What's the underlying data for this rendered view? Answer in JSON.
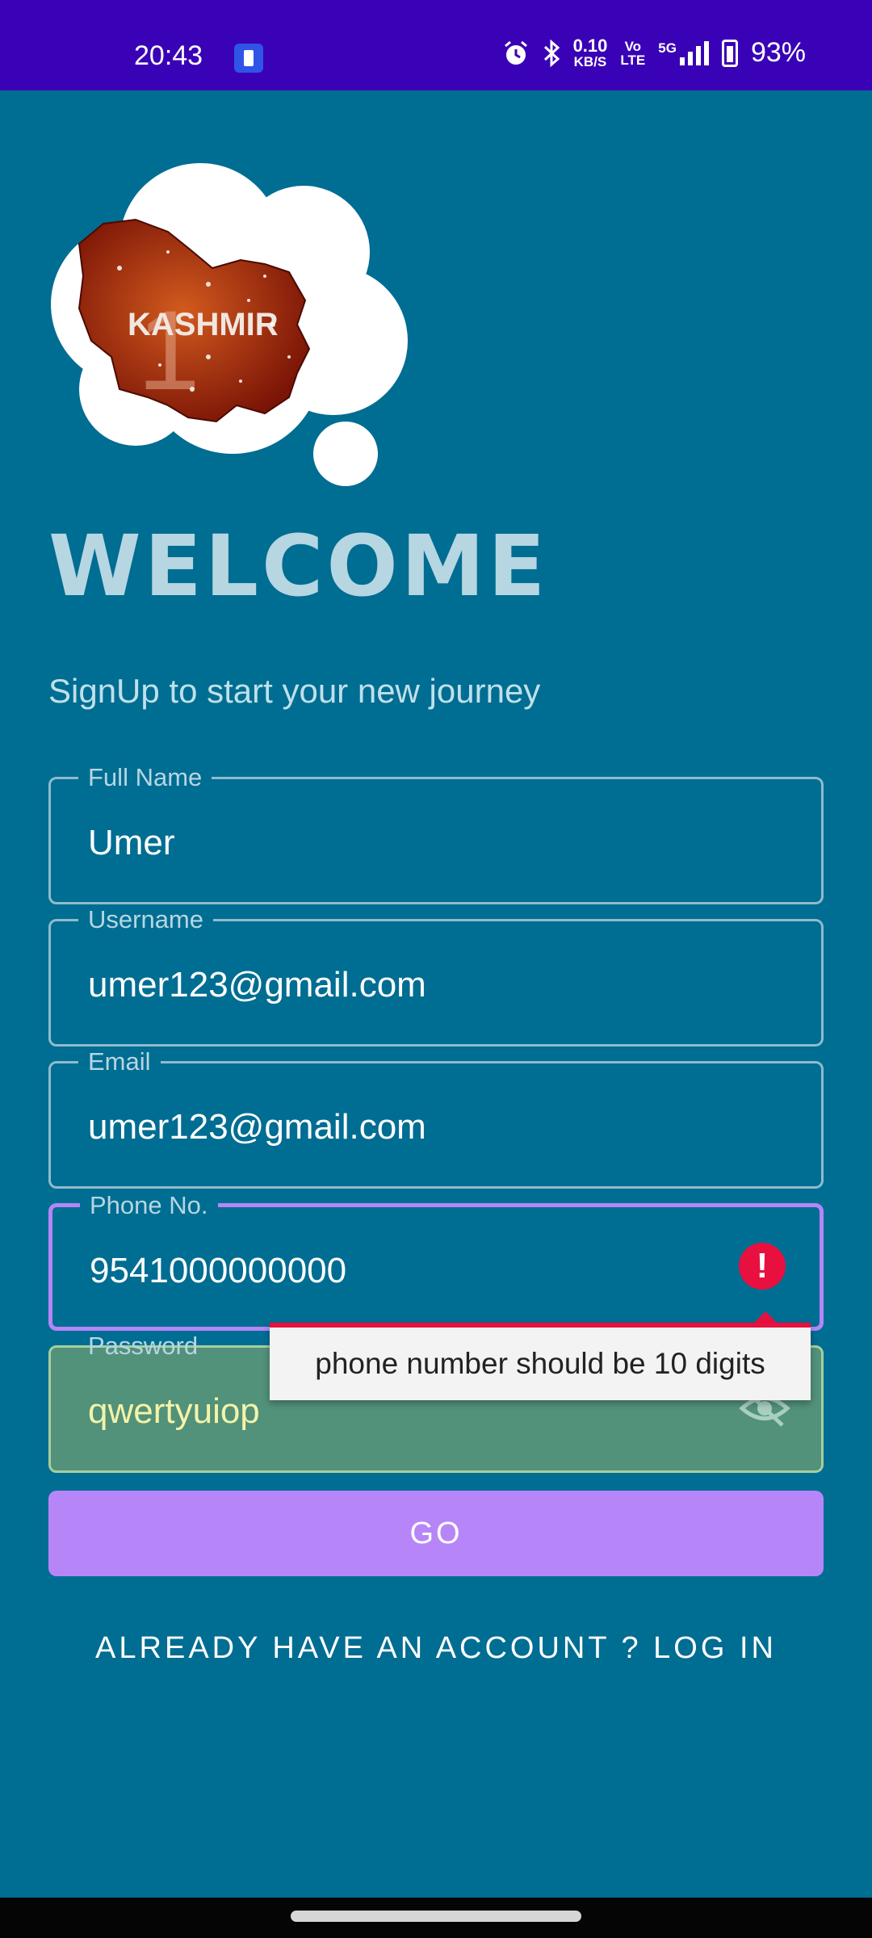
{
  "status_bar": {
    "time": "20:43",
    "net_speed_value": "0.10",
    "net_speed_unit": "KB/S",
    "volte_top": "Vo",
    "volte_bottom": "LTE",
    "network": "5G",
    "battery": "93%"
  },
  "logo": {
    "text": "KASHMIR",
    "number": "1"
  },
  "welcome_title": "WELCOME",
  "subtitle": "SignUp to start your new journey",
  "form": {
    "full_name": {
      "label": "Full Name",
      "value": "Umer"
    },
    "username": {
      "label": "Username",
      "value": "umer123@gmail.com"
    },
    "email": {
      "label": "Email",
      "value": "umer123@gmail.com"
    },
    "phone": {
      "label": "Phone No.",
      "value": "9541000000000"
    },
    "password": {
      "label": "Password",
      "value": "qwertyuiop"
    }
  },
  "error_message": "phone number should be 10 digits",
  "go_button": "GO",
  "login_link": "ALREADY HAVE AN ACCOUNT ? LOG IN",
  "colors": {
    "status_bar": "#3a02b6",
    "background": "#006d92",
    "accent": "#b686f8",
    "error": "#e8103f"
  }
}
